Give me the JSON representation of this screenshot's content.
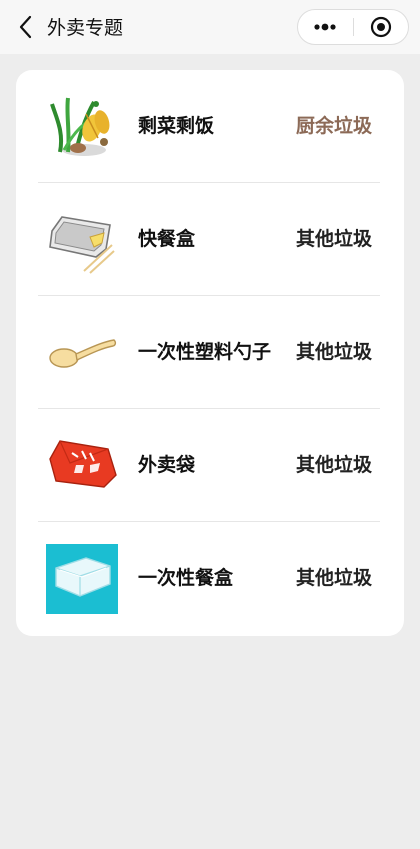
{
  "nav": {
    "title": "外卖专题"
  },
  "items": [
    {
      "name": "剩菜剩饭",
      "category": "厨余垃圾",
      "icon": "leftover-food-icon"
    },
    {
      "name": "快餐盒",
      "category": "其他垃圾",
      "icon": "fast-food-box-icon"
    },
    {
      "name": "一次性塑料勺子",
      "category": "其他垃圾",
      "icon": "plastic-spoon-icon"
    },
    {
      "name": "外卖袋",
      "category": "其他垃圾",
      "icon": "takeout-bag-icon"
    },
    {
      "name": "一次性餐盒",
      "category": "其他垃圾",
      "icon": "disposable-box-icon"
    }
  ],
  "colors": {
    "kitchen_waste": "#8C6A57",
    "other_waste": "#222222",
    "background": "#EDEDED"
  }
}
